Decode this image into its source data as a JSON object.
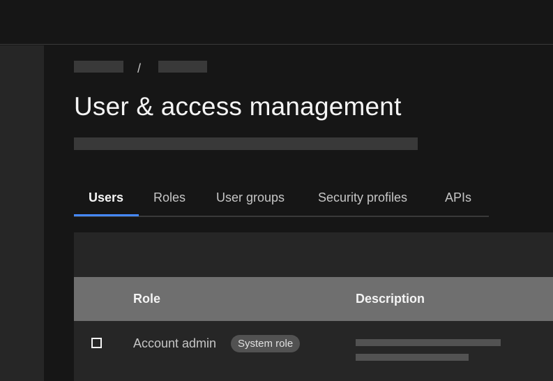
{
  "header": {},
  "breadcrumb": {
    "separator": "/"
  },
  "page": {
    "title": "User & access management"
  },
  "tabs": [
    {
      "label": "Users",
      "active": true
    },
    {
      "label": "Roles",
      "active": false
    },
    {
      "label": "User groups",
      "active": false
    },
    {
      "label": "Security profiles",
      "active": false
    },
    {
      "label": "APIs",
      "active": false
    }
  ],
  "table": {
    "columns": [
      "Role",
      "Description"
    ],
    "rows": [
      {
        "role": "Account admin",
        "tag": "System role"
      }
    ]
  },
  "colors": {
    "background": "#161616",
    "layer": "#262626",
    "active_tab_indicator": "#4589ff",
    "table_header": "#6f6f6f",
    "tag_background": "#525252"
  }
}
